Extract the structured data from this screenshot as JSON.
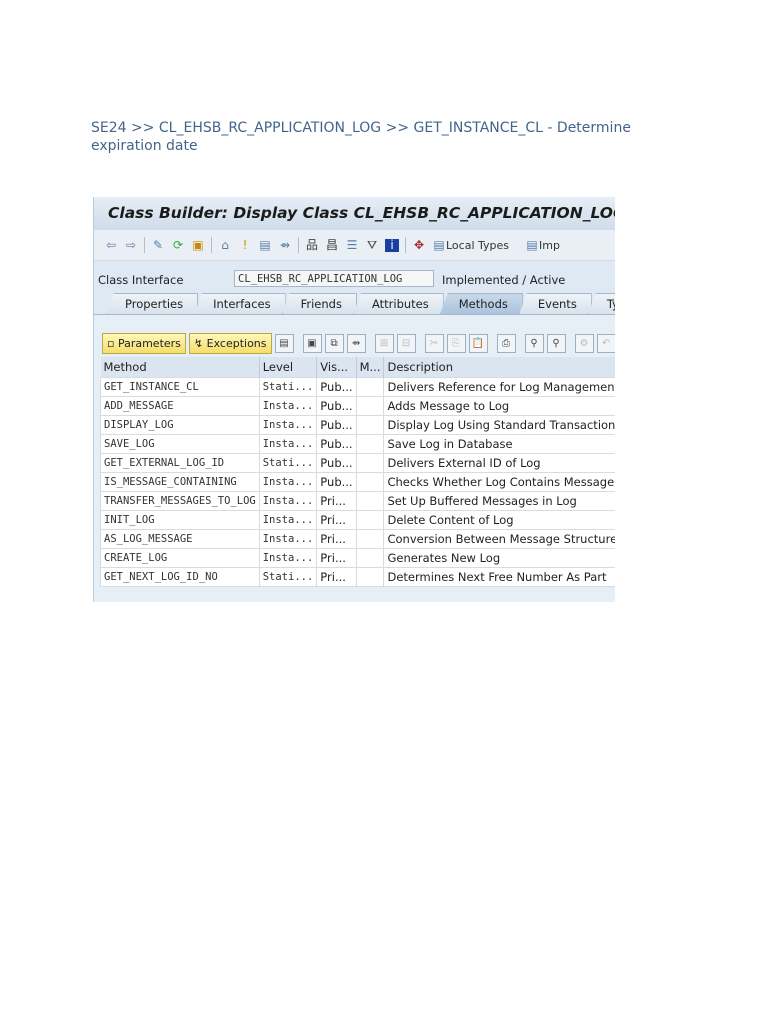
{
  "caption": "SE24 >> CL_EHSB_RC_APPLICATION_LOG  >> GET_INSTANCE_CL - Determine expiration date",
  "window_title": "Class Builder: Display Class CL_EHSB_RC_APPLICATION_LOG",
  "toolbar": {
    "local_types": "Local Types",
    "implementation": "Imp"
  },
  "class_interface": {
    "label": "Class Interface",
    "value": "CL_EHSB_RC_APPLICATION_LOG",
    "status": "Implemented / Active"
  },
  "tabs": [
    "Properties",
    "Interfaces",
    "Friends",
    "Attributes",
    "Methods",
    "Events",
    "Types"
  ],
  "active_tab": "Methods",
  "buttons": {
    "parameters": "Parameters",
    "exceptions": "Exceptions"
  },
  "table": {
    "headers": [
      "Method",
      "Level",
      "Vis...",
      "M...",
      "Description"
    ],
    "rows": [
      [
        "GET_INSTANCE_CL",
        "Stati...",
        "Pub...",
        "",
        "Delivers Reference for Log Management"
      ],
      [
        "ADD_MESSAGE",
        "Insta...",
        "Pub...",
        "",
        "Adds Message to Log"
      ],
      [
        "DISPLAY_LOG",
        "Insta...",
        "Pub...",
        "",
        "Display Log Using Standard Transaction"
      ],
      [
        "SAVE_LOG",
        "Insta...",
        "Pub...",
        "",
        "Save Log in Database"
      ],
      [
        "GET_EXTERNAL_LOG_ID",
        "Stati...",
        "Pub...",
        "",
        "Delivers External ID of Log"
      ],
      [
        "IS_MESSAGE_CONTAINING",
        "Insta...",
        "Pub...",
        "",
        "Checks Whether Log Contains Message(s)"
      ],
      [
        "TRANSFER_MESSAGES_TO_LOG",
        "Insta...",
        "Pri...",
        "",
        "Set Up Buffered Messages in Log"
      ],
      [
        "INIT_LOG",
        "Insta...",
        "Pri...",
        "",
        "Delete Content of Log"
      ],
      [
        "AS_LOG_MESSAGE",
        "Insta...",
        "Pri...",
        "",
        "Conversion Between Message Structures"
      ],
      [
        "CREATE_LOG",
        "Insta...",
        "Pri...",
        "",
        "Generates New Log"
      ],
      [
        "GET_NEXT_LOG_ID_NO",
        "Stati...",
        "Pri...",
        "",
        "Determines Next Free Number As Part"
      ]
    ]
  }
}
